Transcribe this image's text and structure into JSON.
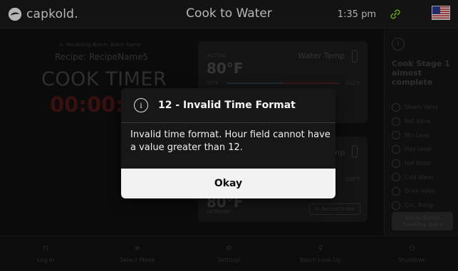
{
  "header": {
    "brand": "capkold.",
    "title": "Cook to Water",
    "time": "1:35 pm",
    "link_icon": "link-icon",
    "flag_icon": "us-flag-icon"
  },
  "main": {
    "recording": "Recording Batch: Batch Name",
    "recipe": "Recipe: RecipeName5",
    "cook_timer_label": "COOK TIMER",
    "cook_timer_value": "00:00:",
    "water_temp_panel": {
      "actual_label": "ACTUAL",
      "actual_value": "80°F",
      "title": "Water Temp",
      "low": "30°F",
      "high": "212°F"
    },
    "second_panel": {
      "title": "mp",
      "high": "200°F",
      "value": "80°F",
      "setpoint_label": "SETPOINT",
      "record_probe": "Record Probe"
    }
  },
  "sidebar": {
    "stage": "Cook Stage 1 almost complete",
    "items": [
      "Steam Valve",
      "Ref. Valve",
      "Min Level",
      "Max Level",
      "Hot Water",
      "Cold Water",
      "Drain Valve",
      "Circ. Pump"
    ],
    "batch_button": "Show Batch Cooking Data"
  },
  "nav": [
    {
      "label": "Log In",
      "icon": "lock-icon"
    },
    {
      "label": "Select Mode",
      "icon": "sliders-icon"
    },
    {
      "label": "Settings",
      "icon": "gear-icon"
    },
    {
      "label": "Batch Look-Up",
      "icon": "search-icon"
    },
    {
      "label": "Shutdown",
      "icon": "power-icon"
    }
  ],
  "modal": {
    "title": "12 - Invalid Time Format",
    "message": "Invalid time format. Hour field cannot have a value greater than 12.",
    "button": "Okay"
  },
  "colors": {
    "accent_green": "#7ed321",
    "timer_red": "#4a1614"
  }
}
